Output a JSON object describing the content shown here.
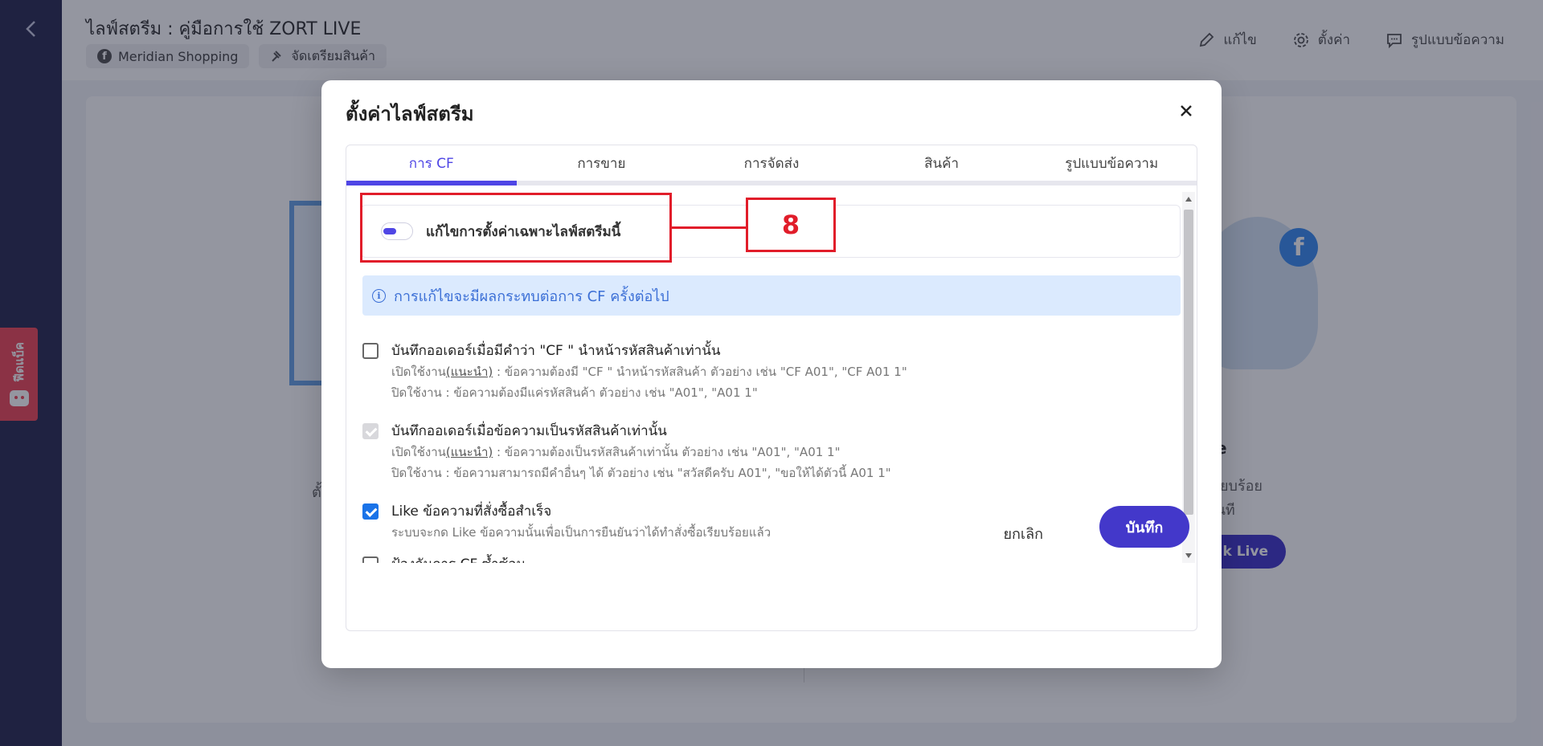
{
  "header": {
    "page_title": "ไลฟ์สตรีม : คู่มือการใช้ ZORT LIVE",
    "chips": [
      {
        "icon": "facebook-icon",
        "label": "Meridian Shopping"
      },
      {
        "icon": "gavel-icon",
        "label": "จัดเตรียมสินค้า"
      }
    ],
    "actions": [
      {
        "icon": "pencil-icon",
        "label": "แก้ไข"
      },
      {
        "icon": "gear-icon",
        "label": "ตั้งค่า"
      },
      {
        "icon": "message-icon",
        "label": "รูปแบบข้อความ"
      }
    ]
  },
  "feedback": {
    "label": "ฟีดแบ็ค"
  },
  "background": {
    "right_title": "ve",
    "right_line1": "ค้าเรียบร้อย",
    "right_line2": "ได้ทันที",
    "right_button": "k Live",
    "left_text": "ตั้"
  },
  "modal": {
    "title": "ตั้งค่าไลฟ์สตรีม",
    "tabs": [
      "การ CF",
      "การขาย",
      "การจัดส่ง",
      "สินค้า",
      "รูปแบบข้อความ"
    ],
    "active_tab": 0,
    "toggle_label": "แก้ไขการตั้งค่าเฉพาะไลฟ์สตรีมนี้",
    "toggle_on": true,
    "info": "การแก้ไขจะมีผลกระทบต่อการ CF ครั้งต่อไป",
    "options": [
      {
        "label": "บันทึกออเดอร์เมื่อมีคำว่า \"CF \" นำหน้ารหัสสินค้าเท่านั้น",
        "state": "unchecked",
        "desc1_prefix": "เปิดใช้งาน",
        "desc1_link": "(แนะนำ)",
        "desc1_rest": " : ข้อความต้องมี \"CF \" นำหน้ารหัสสินค้า ตัวอย่าง เช่น \"CF A01\", \"CF A01 1\"",
        "desc2": "ปิดใช้งาน : ข้อความต้องมีแค่รหัสสินค้า ตัวอย่าง เช่น \"A01\", \"A01 1\""
      },
      {
        "label": "บันทึกออเดอร์เมื่อข้อความเป็นรหัสสินค้าเท่านั้น",
        "state": "disabled",
        "desc1_prefix": "เปิดใช้งาน",
        "desc1_link": "(แนะนำ)",
        "desc1_rest": " : ข้อความต้องเป็นรหัสสินค้าเท่านั้น ตัวอย่าง เช่น \"A01\", \"A01 1\"",
        "desc2": "ปิดใช้งาน : ข้อความสามารถมีคำอื่นๆ ได้ ตัวอย่าง เช่น \"สวัสดีครับ A01\", \"ขอให้ได้ตัวนี้ A01 1\""
      },
      {
        "label": "Like ข้อความที่สั่งซื้อสำเร็จ",
        "state": "checked",
        "desc1": "ระบบจะกด Like ข้อความนั้นเพื่อเป็นการยืนยันว่าได้ทำสั่งซื้อเรียบร้อยแล้ว"
      },
      {
        "label": "ป้องกันการ CF ซ้ำซ้อน",
        "state": "unchecked"
      }
    ],
    "cancel_label": "ยกเลิก",
    "save_label": "บันทึก"
  },
  "annotation": {
    "number": "8"
  },
  "colors": {
    "accent": "#4f46e5",
    "save": "#4338ca",
    "annotation": "#e11d2a",
    "info_bg": "#dbeafe"
  }
}
